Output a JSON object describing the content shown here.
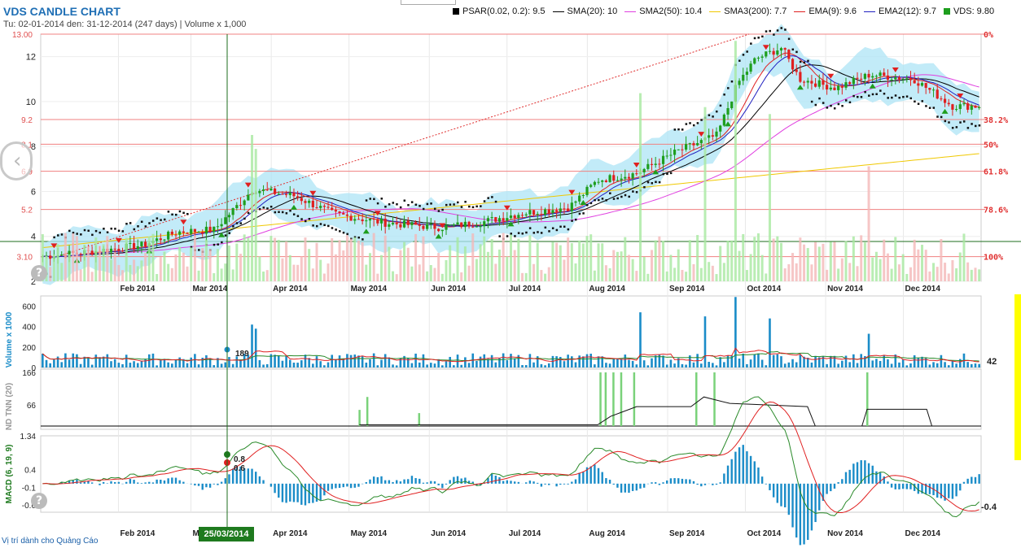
{
  "header": {
    "title": "VDS CANDLE CHART",
    "subtitle": "Tu: 02-01-2014 den: 31-12-2014 (247 days) | Volume x 1,000"
  },
  "legend": [
    {
      "label": "PSAR(0.02, 0.2): 9.5",
      "color": "#000000",
      "kind": "square"
    },
    {
      "label": "SMA(20): 10",
      "color": "#000000",
      "kind": "line"
    },
    {
      "label": "SMA2(50): 10.4",
      "color": "#e040e0",
      "kind": "line"
    },
    {
      "label": "SMA3(200): 7.7",
      "color": "#f0c800",
      "kind": "line"
    },
    {
      "label": "EMA(9): 9.6",
      "color": "#e02020",
      "kind": "line"
    },
    {
      "label": "EMA2(12): 9.7",
      "color": "#2020c0",
      "kind": "line"
    },
    {
      "label": "VDS: 9.80",
      "color": "#1e9e1e",
      "kind": "square"
    }
  ],
  "months": [
    "Feb 2014",
    "Mar 2014",
    "Apr 2014",
    "May 2014",
    "Jun 2014",
    "Jul 2014",
    "Aug 2014",
    "Sep 2014",
    "Oct 2014",
    "Nov 2014",
    "Dec 2014"
  ],
  "chart_data": [
    {
      "type": "candlestick",
      "title": "VDS CANDLE CHART",
      "ylim": [
        2,
        13
      ],
      "yticks": [
        "2",
        "4",
        "6",
        "8",
        "10",
        "12"
      ],
      "close_series": {
        "name": "VDS",
        "anchors": [
          [
            "2014-01-02",
            3.1
          ],
          [
            "2014-01-20",
            3.3
          ],
          [
            "2014-02-10",
            3.6
          ],
          [
            "2014-02-24",
            4.2
          ],
          [
            "2014-03-10",
            4.3
          ],
          [
            "2014-03-20",
            5.5
          ],
          [
            "2014-03-25",
            6.1
          ],
          [
            "2014-04-10",
            5.8
          ],
          [
            "2014-04-25",
            5.0
          ],
          [
            "2014-05-15",
            4.6
          ],
          [
            "2014-06-05",
            4.4
          ],
          [
            "2014-06-20",
            4.6
          ],
          [
            "2014-07-05",
            5.0
          ],
          [
            "2014-07-25",
            5.3
          ],
          [
            "2014-08-05",
            6.5
          ],
          [
            "2014-08-20",
            6.8
          ],
          [
            "2014-09-05",
            7.8
          ],
          [
            "2014-09-20",
            8.5
          ],
          [
            "2014-09-28",
            10.8
          ],
          [
            "2014-10-05",
            11.9
          ],
          [
            "2014-10-15",
            12.4
          ],
          [
            "2014-10-22",
            11.0
          ],
          [
            "2014-11-05",
            10.6
          ],
          [
            "2014-11-18",
            11.2
          ],
          [
            "2014-12-05",
            11.0
          ],
          [
            "2014-12-20",
            9.8
          ],
          [
            "2014-12-31",
            9.8
          ]
        ]
      },
      "fibonacci": [
        {
          "value": "13.00",
          "pct": "0%"
        },
        {
          "value": "9.2",
          "pct": "38.2%"
        },
        {
          "value": "8.1",
          "pct": "50%"
        },
        {
          "value": "6.9",
          "pct": "61.8%"
        },
        {
          "value": "5.2",
          "pct": "78.6%"
        },
        {
          "value": "3.10",
          "pct": "100%"
        }
      ],
      "indicators": {
        "PSAR": "PSAR(0.02, 0.2): 9.5",
        "SMA20": "SMA(20): 10",
        "SMA50": "SMA2(50): 10.4",
        "SMA200": "SMA3(200): 7.7",
        "EMA9": "EMA(9): 9.6",
        "EMA12": "EMA2(12): 9.7"
      }
    },
    {
      "type": "bar",
      "title": "Volume x 1000",
      "ylabel": "Volume x 1000",
      "ylim": [
        0,
        700
      ],
      "yticks": [
        "0",
        "200",
        "400",
        "600"
      ],
      "last_value": "42",
      "cursor_value": "189",
      "peaks": [
        [
          "2014-03-24",
          420
        ],
        [
          "2014-03-26",
          380
        ],
        [
          "2014-08-20",
          600
        ],
        [
          "2014-08-21",
          540
        ],
        [
          "2014-09-15",
          500
        ],
        [
          "2014-09-26",
          690
        ],
        [
          "2014-10-10",
          480
        ],
        [
          "2014-11-17",
          330
        ]
      ]
    },
    {
      "type": "bar",
      "title": "ND TNN (20)",
      "ylabel": "ND TNN (20)",
      "yticks": [
        "166",
        "66"
      ],
      "bars": [
        [
          "2014-05-05",
          50
        ],
        [
          "2014-05-08",
          90
        ],
        [
          "2014-05-28",
          40
        ],
        [
          "2014-08-06",
          166
        ],
        [
          "2014-08-08",
          166
        ],
        [
          "2014-08-11",
          166
        ],
        [
          "2014-08-14",
          166
        ],
        [
          "2014-08-19",
          166
        ],
        [
          "2014-09-12",
          166
        ],
        [
          "2014-09-19",
          166
        ],
        [
          "2014-11-17",
          166
        ]
      ]
    },
    {
      "type": "line",
      "title": "MACD (6, 19, 9)",
      "ylabel": "MACD (6, 19, 9)",
      "yticks": [
        "1.34",
        "0.4",
        "-0.1",
        "-0.6"
      ],
      "last_value": "-0.4",
      "cursor_values": [
        "0.8",
        "0.6"
      ]
    }
  ],
  "cursor": {
    "date_label": "25/03/2014"
  },
  "footer": {
    "ad_text": "Vị trí dành cho Quảng Cáo"
  },
  "nav": {
    "left_arrow": "‹"
  },
  "help": "?"
}
